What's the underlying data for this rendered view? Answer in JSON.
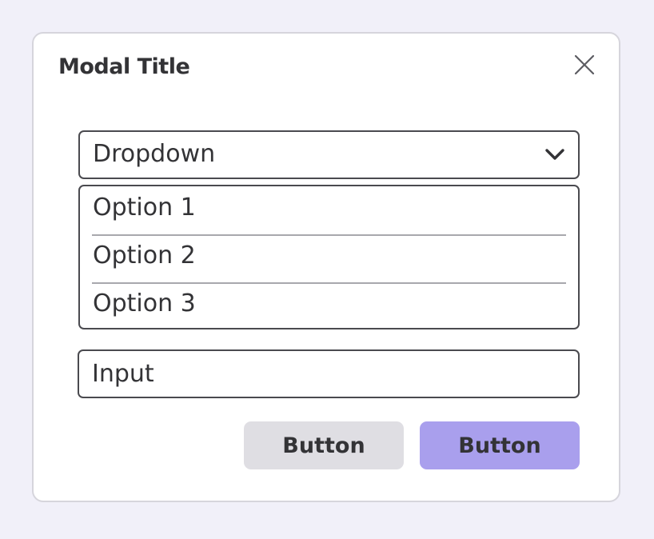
{
  "modal": {
    "title": "Modal Title",
    "close_icon": "close-icon"
  },
  "dropdown": {
    "label": "Dropdown",
    "chevron_icon": "chevron-down-icon",
    "options": [
      "Option 1",
      "Option 2",
      "Option 3"
    ]
  },
  "input": {
    "placeholder": "Input",
    "value": ""
  },
  "buttons": {
    "secondary_label": "Button",
    "primary_label": "Button"
  },
  "colors": {
    "page_background": "#f1f0f9",
    "modal_background": "#ffffff",
    "secondary_button": "#dfdee3",
    "primary_button": "#a99fed",
    "text": "#333336"
  }
}
